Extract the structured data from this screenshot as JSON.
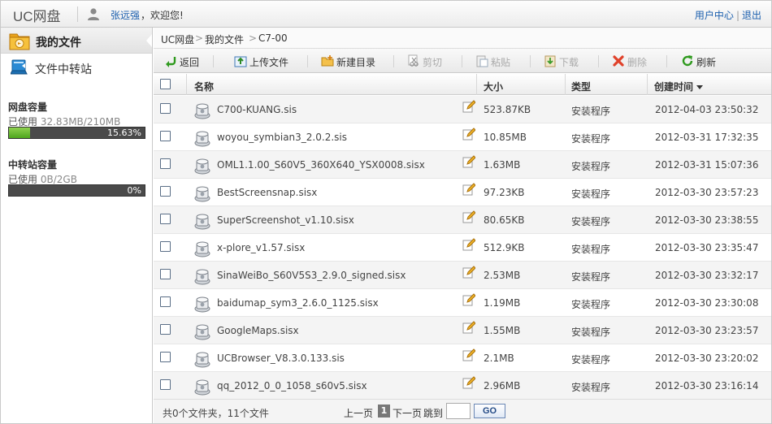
{
  "header": {
    "logo": "UC网盘",
    "username": "张远强",
    "welcome": "，欢迎您!",
    "user_center": "用户中心",
    "sep": "|",
    "logout": "退出"
  },
  "sidebar": {
    "my_files": "我的文件",
    "transfer_station": "文件中转站",
    "disk_capacity": {
      "title": "网盘容量",
      "used_label": "已使用",
      "used_value": "32.83MB/210MB",
      "percent_text": "15.63%",
      "percent": 15.63
    },
    "transfer_capacity": {
      "title": "中转站容量",
      "used_label": "已使用",
      "used_value": "0B/2GB",
      "percent_text": "0%",
      "percent": 0
    }
  },
  "breadcrumb": [
    "UC网盘",
    "我的文件",
    "C7-00"
  ],
  "breadcrumb_sep": ">",
  "toolbar": {
    "back": "返回",
    "upload": "上传文件",
    "new_folder": "新建目录",
    "cut": "剪切",
    "paste": "粘贴",
    "download": "下载",
    "delete": "删除",
    "refresh": "刷新"
  },
  "columns": {
    "name": "名称",
    "size": "大小",
    "type": "类型",
    "created": "创建时间"
  },
  "files": [
    {
      "name": "C700-KUANG.sis",
      "size": "523.87KB",
      "type": "安装程序",
      "date": "2012-04-03 23:50:32"
    },
    {
      "name": "woyou_symbian3_2.0.2.sis",
      "size": "10.85MB",
      "type": "安装程序",
      "date": "2012-03-31 17:32:35"
    },
    {
      "name": "OML1.1.00_S60V5_360X640_YSX0008.sisx",
      "size": "1.63MB",
      "type": "安装程序",
      "date": "2012-03-31 15:07:36"
    },
    {
      "name": "BestScreensnap.sisx",
      "size": "97.23KB",
      "type": "安装程序",
      "date": "2012-03-30 23:57:23"
    },
    {
      "name": "SuperScreenshot_v1.10.sisx",
      "size": "80.65KB",
      "type": "安装程序",
      "date": "2012-03-30 23:38:55"
    },
    {
      "name": "x-plore_v1.57.sisx",
      "size": "512.9KB",
      "type": "安装程序",
      "date": "2012-03-30 23:35:47"
    },
    {
      "name": "SinaWeiBo_S60V5S3_2.9.0_signed.sisx",
      "size": "2.53MB",
      "type": "安装程序",
      "date": "2012-03-30 23:32:17"
    },
    {
      "name": "baidumap_sym3_2.6.0_1125.sisx",
      "size": "1.19MB",
      "type": "安装程序",
      "date": "2012-03-30 23:30:08"
    },
    {
      "name": "GoogleMaps.sisx",
      "size": "1.55MB",
      "type": "安装程序",
      "date": "2012-03-30 23:23:57"
    },
    {
      "name": "UCBrowser_V8.3.0.133.sis",
      "size": "2.1MB",
      "type": "安装程序",
      "date": "2012-03-30 23:20:02"
    },
    {
      "name": "qq_2012_0_0_1058_s60v5.sisx",
      "size": "2.96MB",
      "type": "安装程序",
      "date": "2012-03-30 23:16:14"
    }
  ],
  "footer": {
    "summary": "共0个文件夹，11个文件",
    "prev": "上一页",
    "current_page": "1",
    "next": "下一页",
    "jump_to": "跳到",
    "go": "GO"
  },
  "icons": {
    "user": "user-icon",
    "folder": "folder-icon",
    "transfer": "transfer-station-icon",
    "file": "package-file-icon",
    "edit": "rename-pencil-icon"
  },
  "colors": {
    "link": "#1b5fae",
    "progress_fill": "#4ea51d",
    "progress_track": "#4a4a4a"
  }
}
